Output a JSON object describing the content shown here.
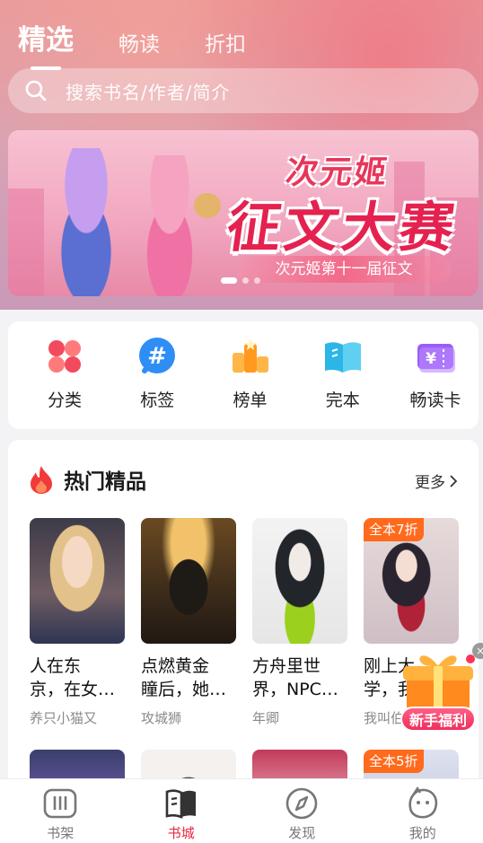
{
  "header": {
    "tabs": [
      {
        "label": "精选",
        "active": true
      },
      {
        "label": "畅读",
        "active": false
      },
      {
        "label": "折扣",
        "active": false
      }
    ]
  },
  "search": {
    "placeholder": "搜索书名/作者/简介",
    "icon": "search-icon"
  },
  "banner": {
    "title_line1": "次元姬",
    "title_line2": "征文大赛",
    "subtitle": "次元姬第十一届征文",
    "dots": 3,
    "active_dot": 0
  },
  "quick_nav": [
    {
      "label": "分类",
      "icon": "category-icon",
      "color": "#f24a5c"
    },
    {
      "label": "标签",
      "icon": "hashtag-icon",
      "color": "#2f8ef5"
    },
    {
      "label": "榜单",
      "icon": "ranking-icon",
      "color": "#ff9a1f"
    },
    {
      "label": "完本",
      "icon": "book-open-icon",
      "color": "#2cb6e8"
    },
    {
      "label": "畅读卡",
      "icon": "ticket-icon",
      "color": "#9b5cf6"
    }
  ],
  "hot": {
    "title": "热门精品",
    "more": "更多",
    "books": [
      {
        "name": "人在东京，在女…",
        "name_l1": "人在东",
        "name_l2": "京，在女…",
        "author": "养只小猫又",
        "tag": ""
      },
      {
        "name": "点燃黄金瞳后，她…",
        "name_l1": "点燃黄金",
        "name_l2": "瞳后，她…",
        "author": "攻城狮",
        "tag": ""
      },
      {
        "name": "方舟里世界，NPC…",
        "name_l1": "方舟里世",
        "name_l2": "界，NPC…",
        "author": "年卿",
        "tag": ""
      },
      {
        "name": "刚上大学，我…",
        "name_l1": "刚上大",
        "name_l2": "学，我…",
        "author": "我叫伯",
        "tag": "全本7折"
      }
    ],
    "row2_tags": [
      "",
      "",
      "",
      "全本5折"
    ]
  },
  "gift": {
    "label": "新手福利",
    "close": "×"
  },
  "tabbar": [
    {
      "label": "书架",
      "icon": "bookshelf-icon",
      "active": false
    },
    {
      "label": "书城",
      "icon": "bookstore-icon",
      "active": true
    },
    {
      "label": "发现",
      "icon": "compass-icon",
      "active": false
    },
    {
      "label": "我的",
      "icon": "profile-icon",
      "active": false
    }
  ],
  "colors": {
    "accent": "#e8283f",
    "tag": "#ff6a1c"
  }
}
